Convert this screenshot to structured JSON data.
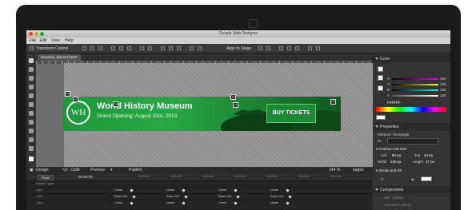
{
  "app": {
    "title": "Google Web Designer"
  },
  "menu": [
    "File",
    "Edit",
    "View",
    "Help"
  ],
  "toolbar": {
    "transform_label": "Transform Control",
    "align_label": "Align to Stage"
  },
  "document": {
    "tab_label": "Museum_Banner.html*"
  },
  "banner": {
    "logo_text": "WH",
    "title": "World History Museum",
    "subtitle": "Grand Opening: August 31st, 2013",
    "cta_label": "BUY TICKETS",
    "colors": {
      "green": "#27a845",
      "dark_green": "#0f5a20"
    }
  },
  "stage_bar": {
    "design": "Design",
    "code": "Code",
    "preview": "Preview",
    "publish": "Publish",
    "zoom": "144 %",
    "page": "page1"
  },
  "timeline": {
    "play_label": "PLAY",
    "time": "00:00.00",
    "ticks": [
      "00:00.00",
      "00:00.50",
      "00:01.00",
      "00:01.50",
      "00:02.00",
      "00:02.50",
      "00:03.00",
      "00:03.50"
    ],
    "rows": [
      {
        "label": "Master Layer",
        "eases": []
      },
      {
        "label": "<div>",
        "eases": [
          "Linear",
          "Linear",
          "Linear",
          "Linear"
        ]
      },
      {
        "label": "<div>",
        "eases": [
          "Ease-Out",
          "Ease-Out",
          "Ease-Out",
          "Ease-Out"
        ]
      },
      {
        "label": "<div>",
        "eases": [
          "Linear",
          "Linear",
          "Linear",
          "Linear"
        ]
      }
    ]
  },
  "panel": {
    "color": {
      "header": "Color",
      "hex": "FFFFFF",
      "r": "255",
      "g": "255",
      "b": "255",
      "a": "100"
    },
    "properties": {
      "header": "Properties",
      "element_label": "Element: Rectangle",
      "id_label": "ID:",
      "pos_header": "Position And Size",
      "left_label": "Left",
      "left_value": "80 px",
      "top_label": "Top",
      "top_value": "24 px",
      "width_label": "Width",
      "width_value": "340 px",
      "height_label": "Height",
      "height_value": "17 px",
      "stroke_header": "Stroke and Fill"
    },
    "components": {
      "header": "Components",
      "items": [
        "360° Gallery",
        "Carousel Gallery"
      ]
    }
  }
}
